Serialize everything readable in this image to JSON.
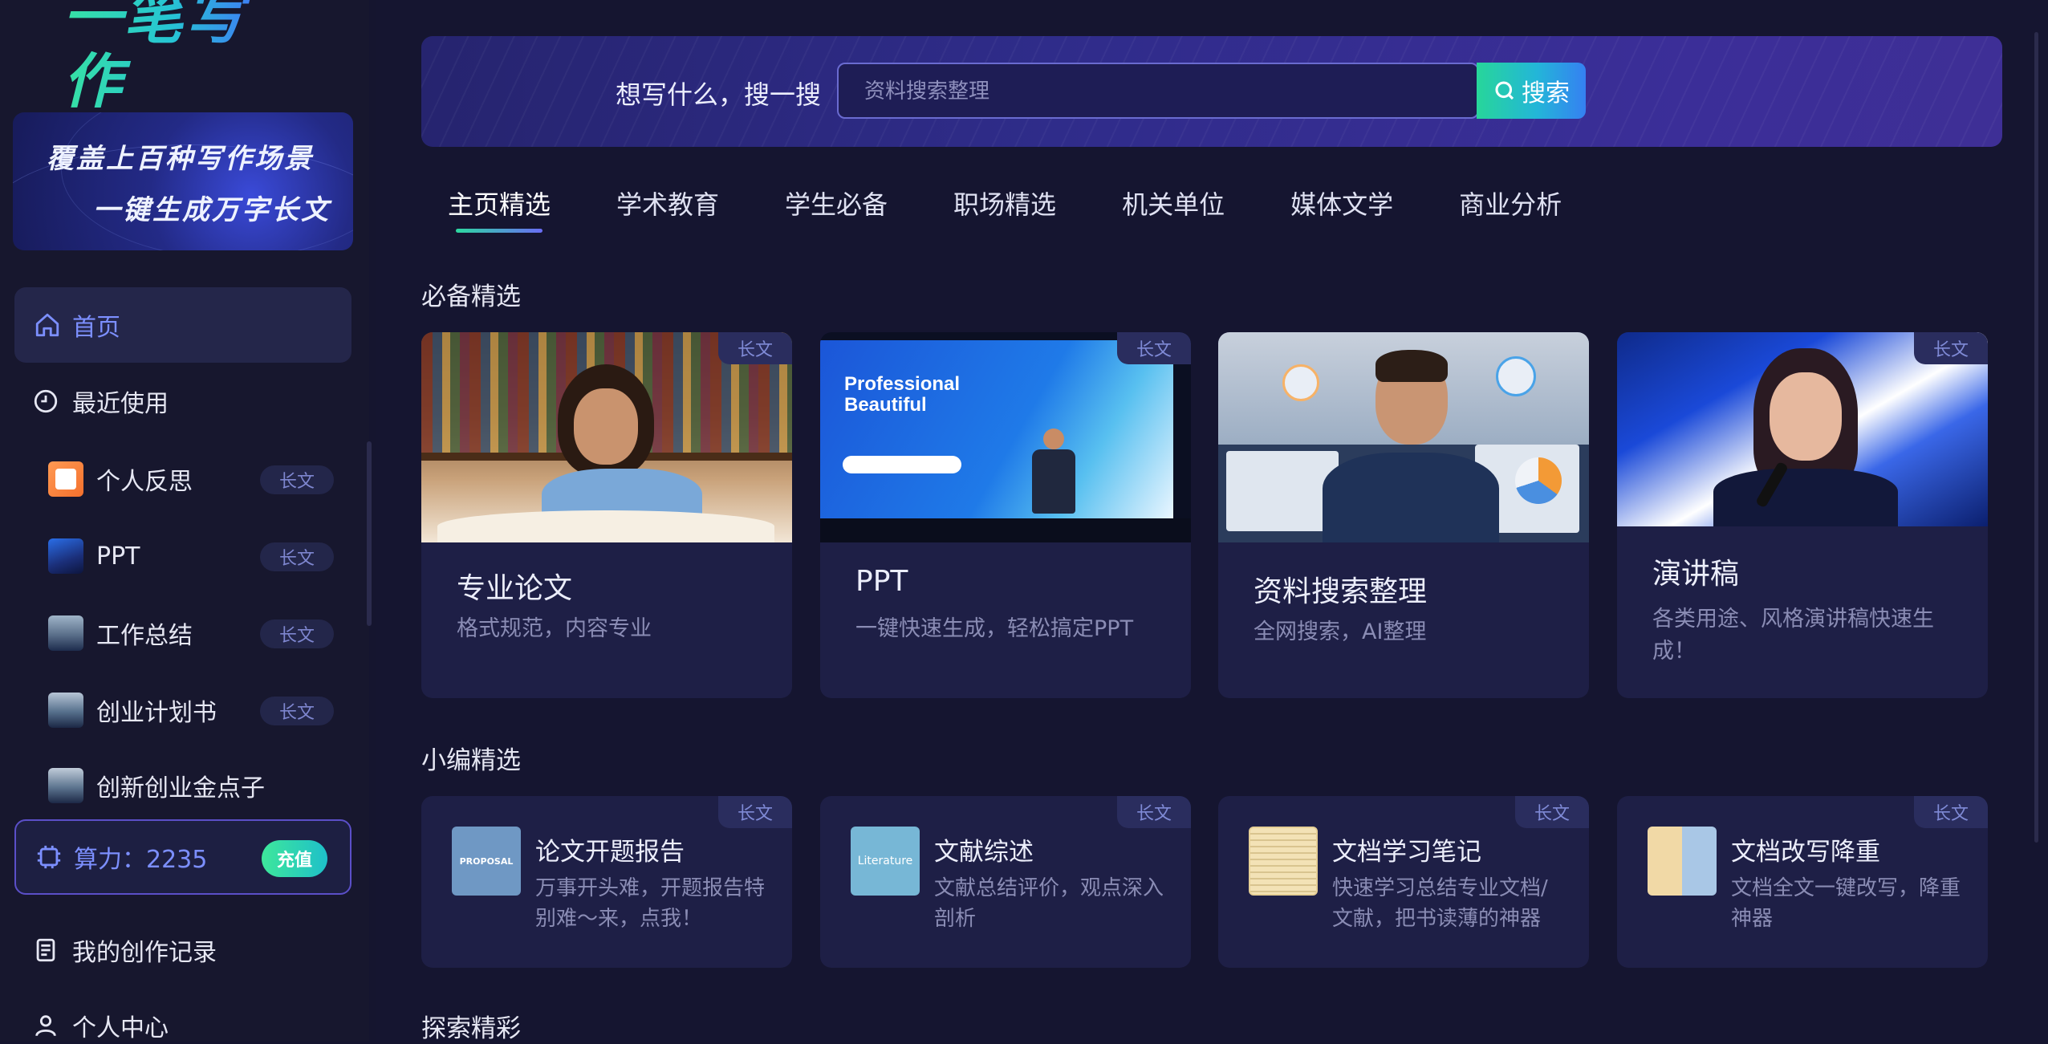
{
  "app": {
    "logo_text": "一笔写作"
  },
  "banner": {
    "line1": "覆盖上百种写作场景",
    "line2": "一键生成万字长文"
  },
  "sidebar": {
    "home_label": "首页",
    "recent_label": "最近使用",
    "recent_items": [
      {
        "label": "个人反思",
        "tag": "长文"
      },
      {
        "label": "PPT",
        "tag": "长文"
      },
      {
        "label": "工作总结",
        "tag": "长文"
      },
      {
        "label": "创业计划书",
        "tag": "长文"
      },
      {
        "label": "创新创业金点子",
        "tag": ""
      }
    ],
    "points_label": "算力：2235",
    "recharge_label": "充值",
    "records_label": "我的创作记录",
    "profile_label": "个人中心"
  },
  "search": {
    "prompt": "想写什么，搜一搜",
    "placeholder": "资料搜索整理",
    "button_label": "搜索"
  },
  "tabs": [
    "主页精选",
    "学术教育",
    "学生必备",
    "职场精选",
    "机关单位",
    "媒体文学",
    "商业分析"
  ],
  "sections": {
    "featured_title": "必备精选",
    "editor_title": "小编精选",
    "explore_title": "探索精彩"
  },
  "featured_cards": [
    {
      "title": "专业论文",
      "desc": "格式规范，内容专业",
      "badge": "长文"
    },
    {
      "title": "PPT",
      "desc": "一键快速生成，轻松搞定PPT",
      "badge": "长文",
      "image_text": [
        "Professional",
        "Beautiful"
      ]
    },
    {
      "title": "资料搜索整理",
      "desc": "全网搜索，AI整理",
      "badge": ""
    },
    {
      "title": "演讲稿",
      "desc": "各类用途、风格演讲稿快速生成！",
      "badge": "长文"
    }
  ],
  "editor_cards": [
    {
      "title": "论文开题报告",
      "desc": "万事开头难，开题报告特别难～来，点我！",
      "badge": "长文",
      "thumb_text": "PROPOSAL"
    },
    {
      "title": "文献综述",
      "desc": "文献总结评价，观点深入剖析",
      "badge": "长文",
      "thumb_text": "Literature"
    },
    {
      "title": "文档学习笔记",
      "desc": "快速学习总结专业文档/文献，把书读薄的神器",
      "badge": "长文",
      "thumb_text": ""
    },
    {
      "title": "文档改写降重",
      "desc": "文档全文一键改写，降重神器",
      "badge": "长文",
      "thumb_text": ""
    }
  ],
  "colors": {
    "accent": "#7c8fff",
    "background": "#151530",
    "card": "#1e1f46",
    "brand_gradient_start": "#37e1a3",
    "brand_gradient_end": "#5a5cf2"
  }
}
